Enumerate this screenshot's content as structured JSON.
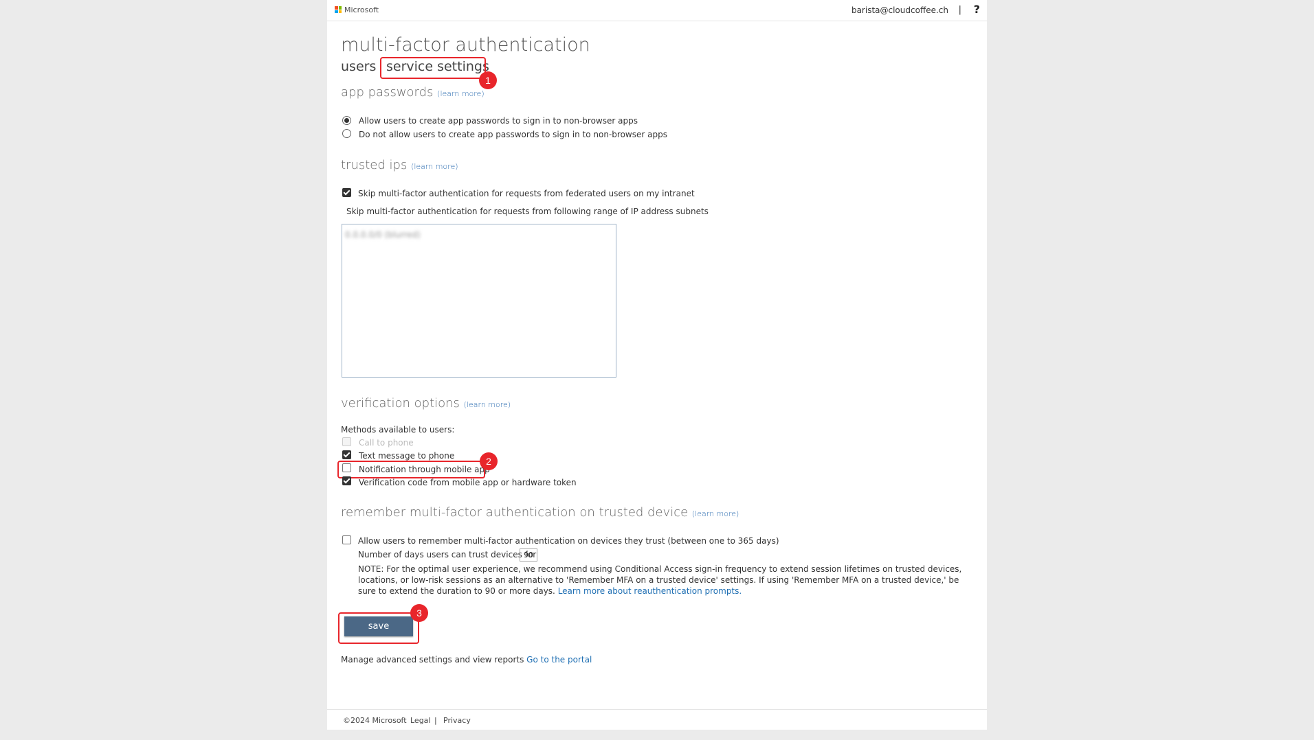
{
  "topbar": {
    "brand": "Microsoft",
    "user": "barista@cloudcoffee.ch",
    "separator": "|",
    "help": "?"
  },
  "page": {
    "title": "multi-factor authentication",
    "tabs": [
      {
        "label": "users"
      },
      {
        "label": "service settings"
      }
    ]
  },
  "app_passwords": {
    "heading": "app passwords",
    "learn_more": "(learn more)",
    "options": [
      {
        "label": "Allow users to create app passwords to sign in to non-browser apps",
        "selected": true
      },
      {
        "label": "Do not allow users to create app passwords to sign in to non-browser apps",
        "selected": false
      }
    ]
  },
  "trusted_ips": {
    "heading": "trusted ips",
    "learn_more": "(learn more)",
    "skip_federated": {
      "label": "Skip multi-factor authentication for requests from federated users on my intranet",
      "checked": true
    },
    "range_label": "Skip multi-factor authentication for requests from following range of IP address subnets",
    "range_value": "0.0.0.0/0 (blurred)"
  },
  "verification": {
    "heading": "verification options",
    "learn_more": "(learn more)",
    "methods_label": "Methods available to users:",
    "methods": [
      {
        "label": "Call to phone",
        "checked": false,
        "disabled": true
      },
      {
        "label": "Text message to phone",
        "checked": true,
        "disabled": false
      },
      {
        "label": "Notification through mobile app",
        "checked": false,
        "disabled": false
      },
      {
        "label": "Verification code from mobile app or hardware token",
        "checked": true,
        "disabled": false
      }
    ]
  },
  "remember": {
    "heading": "remember multi-factor authentication on trusted device",
    "learn_more": "(learn more)",
    "allow": {
      "label": "Allow users to remember multi-factor authentication on devices they trust (between one to 365 days)",
      "checked": false
    },
    "days_label": "Number of days users can trust devices for",
    "days_value": "90",
    "note": "NOTE: For the optimal user experience, we recommend using Conditional Access sign-in frequency to extend session lifetimes on trusted devices, locations, or low-risk sessions as an alternative to 'Remember MFA on a trusted device' settings. If using 'Remember MFA on a trusted device,' be sure to extend the duration to 90 or more days.",
    "note_link": "Learn more about reauthentication prompts."
  },
  "actions": {
    "save": "save"
  },
  "portal": {
    "text": "Manage advanced settings and view reports",
    "link": "Go to the portal"
  },
  "annotations": [
    "1",
    "2",
    "3"
  ],
  "footer": {
    "copyright": "©2024 Microsoft",
    "legal": "Legal",
    "sep": "|",
    "privacy": "Privacy"
  },
  "colors": {
    "accent_button": "#4b6886",
    "annotation_red": "#e8252b",
    "link_blue": "#1f6fb3"
  }
}
